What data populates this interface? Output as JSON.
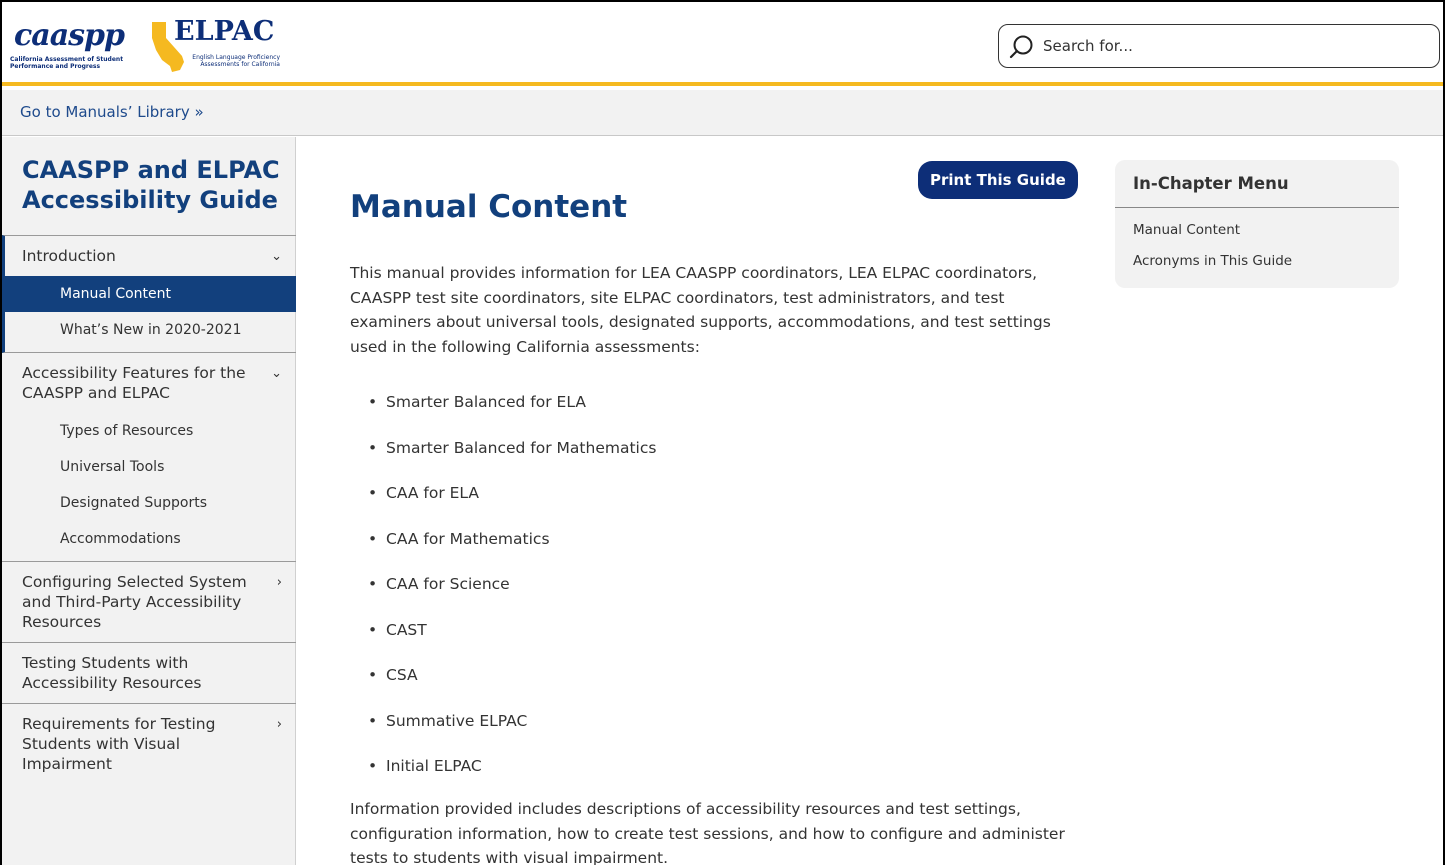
{
  "header": {
    "caaspp_logo": {
      "word": "caaspp",
      "tagline": "California Assessment of Student Performance and Progress"
    },
    "elpac_logo": {
      "word": "ELPAC",
      "tagline": "English Language Proficiency Assessments for California"
    },
    "search": {
      "placeholder": "Search for..."
    },
    "accent_color": "#f5b920"
  },
  "library_link": "Go to Manuals’ Library »",
  "sidebar": {
    "title": "CAASPP and ELPAC Accessibility Guide",
    "sections": [
      {
        "label": "Introduction",
        "caret": "⌄",
        "items": [
          "Manual Content",
          "What’s New in 2020-2021"
        ],
        "active_item": "Manual Content"
      },
      {
        "label": "Accessibility Features for the CAASPP and ELPAC",
        "caret": "⌄",
        "items": [
          "Types of Resources",
          "Universal Tools",
          "Designated Supports",
          "Accommodations"
        ]
      },
      {
        "label": "Configuring Selected System and Third-Party Accessibility Resources",
        "caret": "›"
      },
      {
        "label": "Testing Students with Accessibility Resources"
      },
      {
        "label": "Requirements for Testing Students with Visual Impairment",
        "caret": "›"
      }
    ]
  },
  "main": {
    "print_button": "Print This Guide",
    "title": "Manual Content",
    "intro_paragraph": "This manual provides information for LEA CAASPP coordinators, LEA ELPAC coordinators, CAASPP test site coordinators, site ELPAC coordinators, test administrators, and test examiners about universal tools, designated supports, accommodations, and test settings used in the following California assessments:",
    "assessments": [
      "Smarter Balanced for ELA",
      "Smarter Balanced for Mathematics",
      "CAA for ELA",
      "CAA for Mathematics",
      "CAA for Science",
      "CAST",
      "CSA",
      "Summative ELPAC",
      "Initial ELPAC"
    ],
    "second_paragraph": "Information provided includes descriptions of accessibility resources and test settings, configuration information, how to create test sessions, and how to configure and administer tests to students with visual impairment."
  },
  "in_chapter_menu": {
    "title": "In-Chapter Menu",
    "links": [
      "Manual Content",
      "Acronyms in This Guide"
    ]
  },
  "colors": {
    "brand_blue": "#12407d",
    "button_blue": "#0d2e78"
  }
}
